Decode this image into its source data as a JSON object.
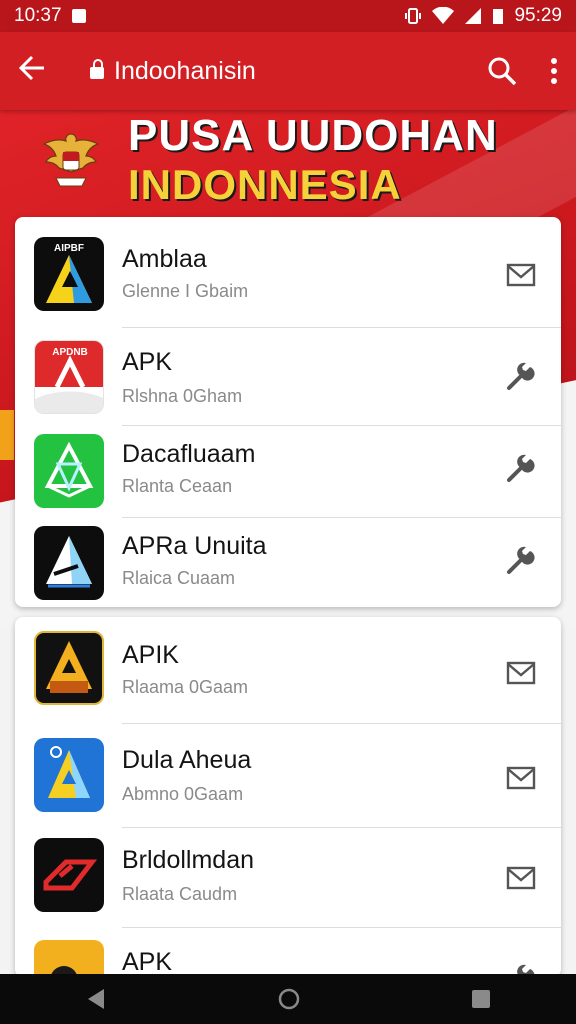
{
  "status_bar": {
    "time": "10:37",
    "battery_time": "95:29"
  },
  "toolbar": {
    "title": "Indoohanisin"
  },
  "banner": {
    "line1": "PUSA UUDOHAN",
    "line2": "INDONNESIA"
  },
  "card1": {
    "items": [
      {
        "name": "Amblaa",
        "subtitle": "Glenne I Gbaim",
        "icon_text": "AIPBF",
        "icon": "triangle-app-icon",
        "action": "envelope-icon"
      },
      {
        "name": "APK",
        "subtitle": "Rlshna 0Gham",
        "icon_text": "APDNB",
        "icon": "red-ribbon-app-icon",
        "action": "wrench-icon"
      },
      {
        "name": "Dacafluaam",
        "subtitle": "Rlanta Ceaan",
        "icon": "green-gem-app-icon",
        "action": "wrench-icon"
      },
      {
        "name": "APRa Unuita",
        "subtitle": "Rlaica Cuaam",
        "icon": "black-pyramid-app-icon",
        "action": "wrench-icon"
      }
    ]
  },
  "card2": {
    "items": [
      {
        "name": "APIK",
        "subtitle": "Rlaama 0Gaam",
        "icon": "gold-a-app-icon",
        "action": "envelope-icon"
      },
      {
        "name": "Dula Aheua",
        "subtitle": "Abmno 0Gaam",
        "icon": "blue-a-app-icon",
        "action": "envelope-icon"
      },
      {
        "name": "Brldollmdan",
        "subtitle": "Rlaata Caudm",
        "icon": "red-arrow-app-icon",
        "action": "envelope-icon"
      },
      {
        "name": "APK",
        "subtitle": "",
        "icon": "yellow-app-icon",
        "action": "wrench-icon"
      }
    ]
  }
}
